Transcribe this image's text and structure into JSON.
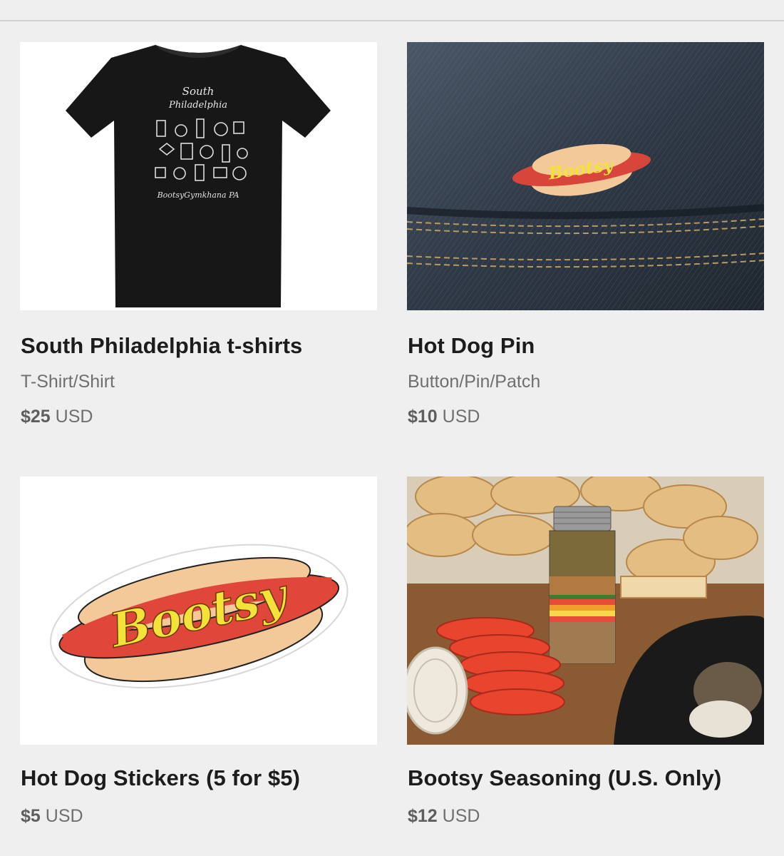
{
  "products": [
    {
      "title": "South Philadelphia t-shirts",
      "category": "T-Shirt/Shirt",
      "price_amount": "$25",
      "price_currency": "USD",
      "image": "t-shirt-image",
      "shirt_print_lines": [
        "South",
        "Philadelphia",
        "BootsyGymkhana PA"
      ]
    },
    {
      "title": "Hot Dog Pin",
      "category": "Button/Pin/Patch",
      "price_amount": "$10",
      "price_currency": "USD",
      "image": "hot-dog-pin-on-denim-image",
      "pin_text": "Bootsy"
    },
    {
      "title": "Hot Dog Stickers (5 for $5)",
      "price_amount": "$5",
      "price_currency": "USD",
      "image": "hot-dog-sticker-image",
      "sticker_text": "Bootsy"
    },
    {
      "title": "Bootsy Seasoning (U.S. Only)",
      "price_amount": "$12",
      "price_currency": "USD",
      "image": "seasoning-jar-with-buns-and-tomatoes-image"
    }
  ],
  "colors": {
    "page_background": "#efefef",
    "title_text": "#1c1c1c",
    "meta_text": "#6f6f6f",
    "hotdog_sausage": "#e0473a",
    "hotdog_bun": "#f6c995",
    "hotdog_lettering": "#f2e23a"
  }
}
